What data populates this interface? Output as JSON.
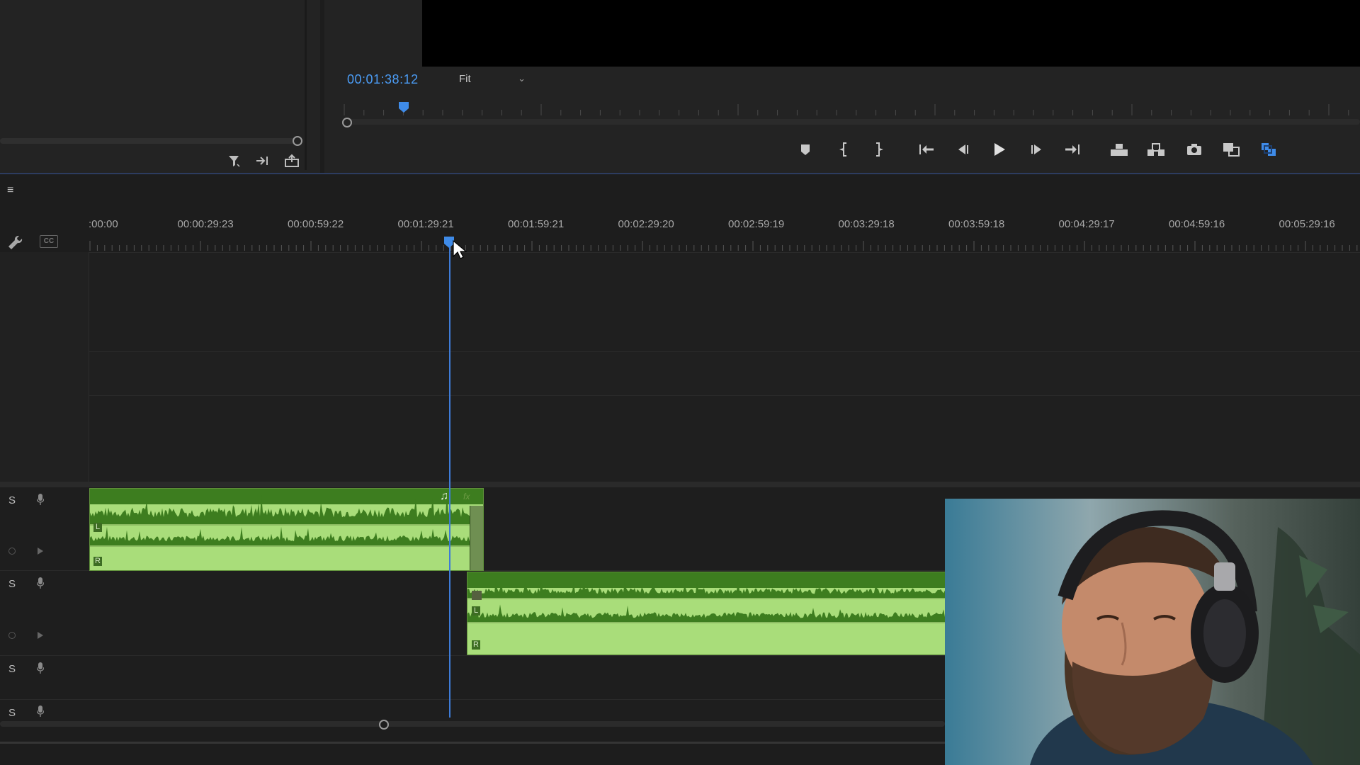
{
  "monitor": {
    "timecode": "00:01:38:12",
    "zoom_select": "Fit",
    "transport_buttons": [
      "add-marker",
      "mark-in",
      "mark-out",
      "go-to-in",
      "step-back",
      "play",
      "step-forward",
      "go-to-out",
      "insert",
      "overwrite",
      "export-frame",
      "comparison-view",
      "multi-camera"
    ]
  },
  "project_panel": {
    "buttons": [
      "filter-icon",
      "automate-to-sequence-icon",
      "new-item-icon"
    ]
  },
  "timeline": {
    "menu_icon": "≡",
    "ruler_labels": [
      ":00:00",
      "00:00:29:23",
      "00:00:59:22",
      "00:01:29:21",
      "00:01:59:21",
      "00:02:29:20",
      "00:02:59:19",
      "00:03:29:18",
      "00:03:59:18",
      "00:04:29:17",
      "00:04:59:16",
      "00:05:29:16"
    ],
    "cc_label": "CC",
    "audio_tracks": [
      {
        "solo": "S"
      },
      {
        "solo": "S"
      },
      {
        "solo": "S"
      },
      {
        "solo": "S"
      }
    ],
    "clips": [
      {
        "channels": [
          "L",
          "R"
        ],
        "badges": [
          "♫",
          "fx"
        ]
      },
      {
        "channels": [
          "L",
          "R"
        ]
      }
    ]
  },
  "colors": {
    "accent": "#4b9cf5",
    "clip_body": "#a9dd7a",
    "clip_header": "#3d7d1f",
    "background": "#1d1d1d"
  }
}
